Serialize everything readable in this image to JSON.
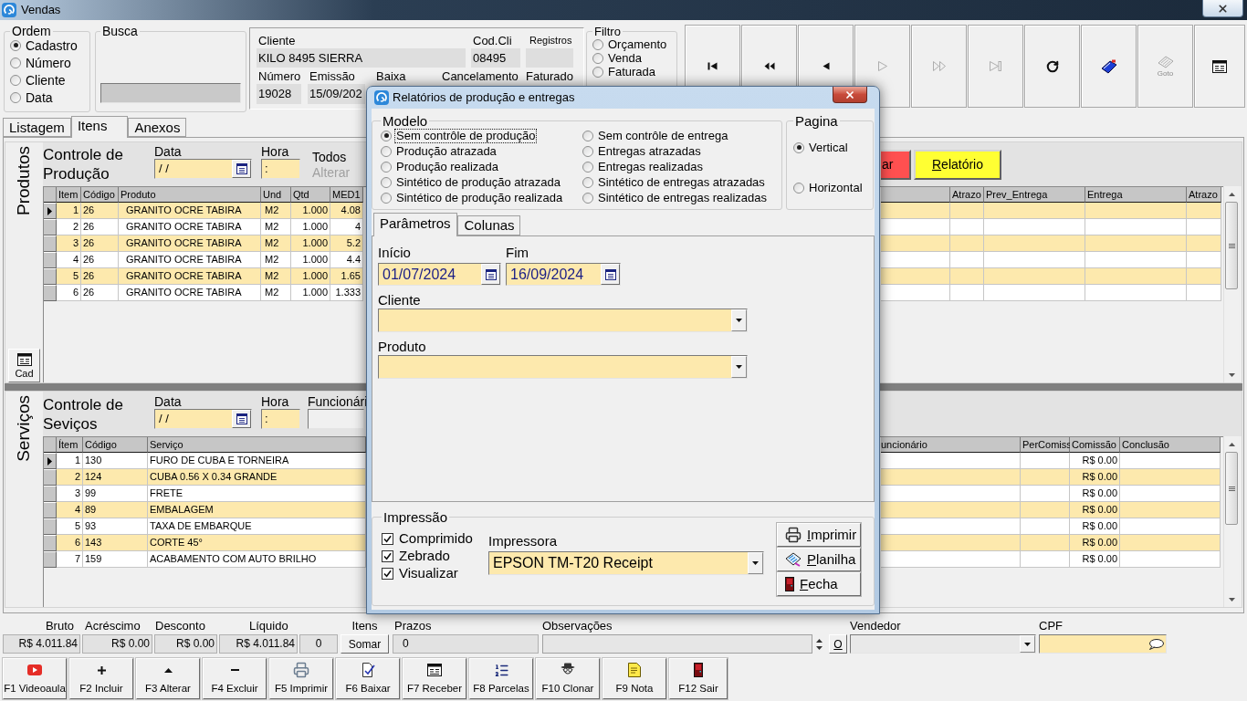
{
  "window": {
    "title": "Vendas"
  },
  "ordem": {
    "label": "Ordem",
    "options": [
      {
        "label": "Cadastro",
        "selected": true
      },
      {
        "label": "Número",
        "selected": false
      },
      {
        "label": "Cliente",
        "selected": false
      },
      {
        "label": "Data",
        "selected": false
      }
    ]
  },
  "busca": {
    "label": "Busca"
  },
  "record": {
    "cliente": {
      "label": "Cliente",
      "value": "KILO 8495 SIERRA"
    },
    "cod_cli": {
      "label": "Cod.Cli",
      "value": "08495"
    },
    "registros": {
      "label": "Registros"
    },
    "numero": {
      "label": "Número",
      "value": "19028"
    },
    "emissao": {
      "label": "Emissão",
      "value": "15/09/202"
    },
    "baixa": {
      "label": "Baixa"
    },
    "cancelamento": {
      "label": "Cancelamento"
    },
    "faturado": {
      "label": "Faturado"
    }
  },
  "filtro": {
    "label": "Filtro",
    "options": [
      {
        "label": "Orçamento",
        "selected": false
      },
      {
        "label": "Venda",
        "selected": false
      },
      {
        "label": "Faturada",
        "selected": false
      }
    ]
  },
  "toolbar": [
    {
      "kind": "first",
      "disabled": false
    },
    {
      "kind": "prior_page",
      "disabled": false
    },
    {
      "kind": "prior",
      "disabled": false
    },
    {
      "kind": "next",
      "disabled": true
    },
    {
      "kind": "next_page",
      "disabled": true
    },
    {
      "kind": "last",
      "disabled": true
    },
    {
      "kind": "refresh",
      "disabled": false
    },
    {
      "kind": "bookmark",
      "disabled": false
    },
    {
      "kind": "goto",
      "label": "Goto",
      "disabled": true
    },
    {
      "kind": "form",
      "disabled": false
    }
  ],
  "tabs": [
    {
      "label": "Listagem",
      "selected": false
    },
    {
      "label": "Itens",
      "selected": true
    },
    {
      "label": "Anexos",
      "selected": false
    }
  ],
  "produtos": {
    "side_label": "Produtos",
    "title": "Controle de Produção",
    "data": {
      "label": "Data",
      "value": "/ /"
    },
    "hora": {
      "label": "Hora",
      "value": ":"
    },
    "todos": {
      "label": "Todos",
      "disabled": false
    },
    "alterar": {
      "label": "Alterar",
      "disabled": true
    },
    "buttons": [
      {
        "label": "ar",
        "color": "#ff5050",
        "mnemonic": false
      },
      {
        "label": "Relatório",
        "color": "#ffff33",
        "mnemonic": true
      }
    ],
    "columns": [
      "Item",
      "Código",
      "Produto",
      "Und",
      "Qtd",
      "MED1",
      "Atrazo",
      "Prev_Entrega",
      "Entrega",
      "Atrazo"
    ],
    "rows": [
      {
        "item": "1",
        "codigo": "26",
        "produto": "GRANITO OCRE TABIRA",
        "und": "M2",
        "qtd": "1.000",
        "med1": "4.08",
        "selected": true
      },
      {
        "item": "2",
        "codigo": "26",
        "produto": "GRANITO OCRE TABIRA",
        "und": "M2",
        "qtd": "1.000",
        "med1": "4",
        "selected": false
      },
      {
        "item": "3",
        "codigo": "26",
        "produto": "GRANITO OCRE TABIRA",
        "und": "M2",
        "qtd": "1.000",
        "med1": "5.2",
        "selected": false
      },
      {
        "item": "4",
        "codigo": "26",
        "produto": "GRANITO OCRE TABIRA",
        "und": "M2",
        "qtd": "1.000",
        "med1": "4.4",
        "selected": false
      },
      {
        "item": "5",
        "codigo": "26",
        "produto": "GRANITO OCRE TABIRA",
        "und": "M2",
        "qtd": "1.000",
        "med1": "1.65",
        "selected": false
      },
      {
        "item": "6",
        "codigo": "26",
        "produto": "GRANITO OCRE TABIRA",
        "und": "M2",
        "qtd": "1.000",
        "med1": "1.333",
        "selected": false
      }
    ],
    "cad_button": "Cad"
  },
  "servicos": {
    "side_label": "Serviços",
    "title": "Controle de Seviços",
    "data": {
      "label": "Data",
      "value": "/ /"
    },
    "hora": {
      "label": "Hora",
      "value": ":"
    },
    "funcionario": {
      "label": "Funcionári"
    },
    "columns": [
      "Ítem",
      "Código",
      "Serviço",
      "uncionário",
      "PerComiss",
      "Comissão",
      "Conclusão"
    ],
    "rows": [
      {
        "item": "1",
        "codigo": "130",
        "servico": "FURO DE CUBA E TORNEIRA",
        "comissao": "R$ 0.00",
        "selected": true
      },
      {
        "item": "2",
        "codigo": "124",
        "servico": "CUBA 0.56 X 0.34 GRANDE",
        "comissao": "R$ 0.00",
        "selected": false
      },
      {
        "item": "3",
        "codigo": "99",
        "servico": "FRETE",
        "comissao": "R$ 0.00",
        "selected": false
      },
      {
        "item": "4",
        "codigo": "89",
        "servico": "EMBALAGEM",
        "comissao": "R$ 0.00",
        "selected": false
      },
      {
        "item": "5",
        "codigo": "93",
        "servico": "TAXA DE EMBARQUE",
        "comissao": "R$ 0.00",
        "selected": false
      },
      {
        "item": "6",
        "codigo": "143",
        "servico": "CORTE 45°",
        "comissao": "R$ 0.00",
        "selected": false
      },
      {
        "item": "7",
        "codigo": "159",
        "servico": "ACABAMENTO COM AUTO BRILHO",
        "comissao": "R$ 0.00",
        "selected": false
      }
    ]
  },
  "totals": [
    {
      "label": "Bruto",
      "value": "R$ 4.011.84"
    },
    {
      "label": "Acréscimo",
      "value": "R$ 0.00"
    },
    {
      "label": "Desconto",
      "value": "R$ 0.00"
    },
    {
      "label": "Líquido",
      "value": "R$ 4.011.84"
    }
  ],
  "itens": {
    "label": "Itens",
    "value": "0",
    "button": "Somar"
  },
  "prazos": {
    "label": "Prazos",
    "value": "0"
  },
  "observacoes": {
    "label": "Observações",
    "button": {
      "label": "O",
      "mnemonic": true
    }
  },
  "vendedor": {
    "label": "Vendedor"
  },
  "cpf": {
    "label": "CPF"
  },
  "function_keys": [
    {
      "label": "F1 Videoaula",
      "kind": "video"
    },
    {
      "label": "F2 Incluir",
      "kind": "add"
    },
    {
      "label": "F3 Alterar",
      "kind": "edit"
    },
    {
      "label": "F4 Excluir",
      "kind": "delete"
    },
    {
      "label": "F5 Imprimir",
      "kind": "print"
    },
    {
      "label": "F6 Baixar",
      "kind": "settle"
    },
    {
      "label": "F7 Receber",
      "kind": "receive"
    },
    {
      "label": "F8 Parcelas",
      "kind": "installments"
    },
    {
      "label": "F10 Clonar",
      "kind": "clone"
    },
    {
      "label": "F9 Nota",
      "kind": "note"
    },
    {
      "label": "F12 Sair",
      "kind": "exit"
    }
  ],
  "dialog": {
    "title": "Relatórios de produção e entregas",
    "modelo": {
      "label": "Modelo",
      "options": [
        {
          "label": "Sem contrôle de produção",
          "selected": true,
          "focused": true
        },
        {
          "label": "Produção atrazada",
          "selected": false,
          "focused": false
        },
        {
          "label": "Produção realizada",
          "selected": false,
          "focused": false
        },
        {
          "label": "Sintético de produção atrazada",
          "selected": false,
          "focused": false
        },
        {
          "label": "Sintético de produção realizada",
          "selected": false,
          "focused": false
        },
        {
          "label": "Sem contrôle de entrega",
          "selected": false,
          "focused": false
        },
        {
          "label": "Entregas atrazadas",
          "selected": false,
          "focused": false
        },
        {
          "label": "Entregas realizadas",
          "selected": false,
          "focused": false
        },
        {
          "label": "Sintético de entregas atrazadas",
          "selected": false,
          "focused": false
        },
        {
          "label": "Sintético de entregas realizadas",
          "selected": false,
          "focused": false
        }
      ]
    },
    "pagina": {
      "label": "Pagina",
      "options": [
        {
          "label": "Vertical",
          "selected": true
        },
        {
          "label": "Horizontal",
          "selected": false
        }
      ]
    },
    "tabs": [
      {
        "label": "Parâmetros",
        "selected": true
      },
      {
        "label": "Colunas",
        "selected": false
      }
    ],
    "inicio": {
      "label": "Início",
      "value": "01/07/2024"
    },
    "fim": {
      "label": "Fim",
      "value": "16/09/2024"
    },
    "cliente": {
      "label": "Cliente"
    },
    "produto": {
      "label": "Produto"
    },
    "impressao": {
      "label": "Impressão",
      "options": [
        {
          "label": "Comprimido",
          "checked": true
        },
        {
          "label": "Zebrado",
          "checked": true
        },
        {
          "label": "Visualizar",
          "checked": true
        }
      ],
      "impressora": {
        "label": "Impressora",
        "value": "EPSON TM-T20 Receipt"
      }
    },
    "buttons": [
      {
        "label": "Imprimir",
        "kind": "print",
        "mnemonic": true
      },
      {
        "label": "Planilha",
        "kind": "sheet",
        "mnemonic": true
      },
      {
        "label": "Fecha",
        "kind": "exit",
        "mnemonic": true
      }
    ]
  }
}
